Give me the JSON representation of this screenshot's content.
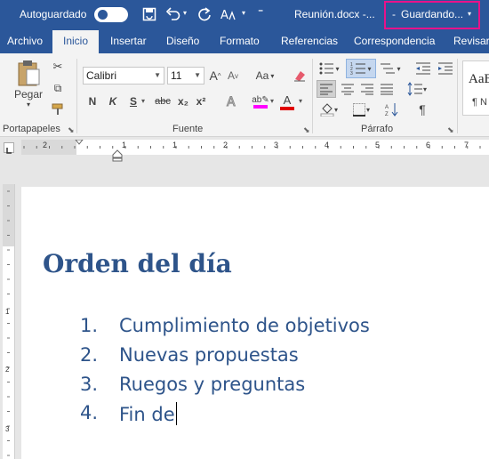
{
  "title_bar": {
    "autosave_label": "Autoguardado",
    "doc_title": "Reunión.docx  -...",
    "saving_status": "Guardando...",
    "colors": {
      "bar": "#2b579a",
      "highlight_box": "#e8128a"
    },
    "icons": [
      "save-icon",
      "undo-icon",
      "redo-icon",
      "touch-mode-icon",
      "customize-icon"
    ]
  },
  "tabs": [
    {
      "label": "Archivo"
    },
    {
      "label": "Inicio",
      "active": true
    },
    {
      "label": "Insertar"
    },
    {
      "label": "Diseño"
    },
    {
      "label": "Formato"
    },
    {
      "label": "Referencias"
    },
    {
      "label": "Correspondencia"
    },
    {
      "label": "Revisar"
    }
  ],
  "ribbon": {
    "paste_label": "Pegar",
    "font_name": "Calibri",
    "font_size": "11",
    "bold": "N",
    "italic": "K",
    "underline": "S",
    "strike": "abc",
    "subscript": "x₂",
    "superscript": "x²",
    "change_case": "Aa",
    "style_preview": "AaB",
    "style_name": "¶ N",
    "pilcrow": "¶",
    "groups": {
      "clipboard": "Portapapeles",
      "font": "Fuente",
      "paragraph": "Párrafo"
    },
    "colors": {
      "highlight": "#ff00ff",
      "font_color": "#e00000"
    }
  },
  "ruler": {
    "marks": [
      "2",
      "1",
      "1",
      "2",
      "3",
      "4",
      "5",
      "6",
      "7"
    ],
    "vertical_marks": [
      "1",
      "2",
      "3"
    ]
  },
  "document": {
    "heading": "Orden del día",
    "list": [
      {
        "num": "1.",
        "text": "Cumplimiento de objetivos"
      },
      {
        "num": "2.",
        "text": "Nuevas propuestas"
      },
      {
        "num": "3.",
        "text": "Ruegos y preguntas"
      },
      {
        "num": "4.",
        "text": "Fin de"
      }
    ],
    "colors": {
      "heading": "#2e548a"
    }
  }
}
